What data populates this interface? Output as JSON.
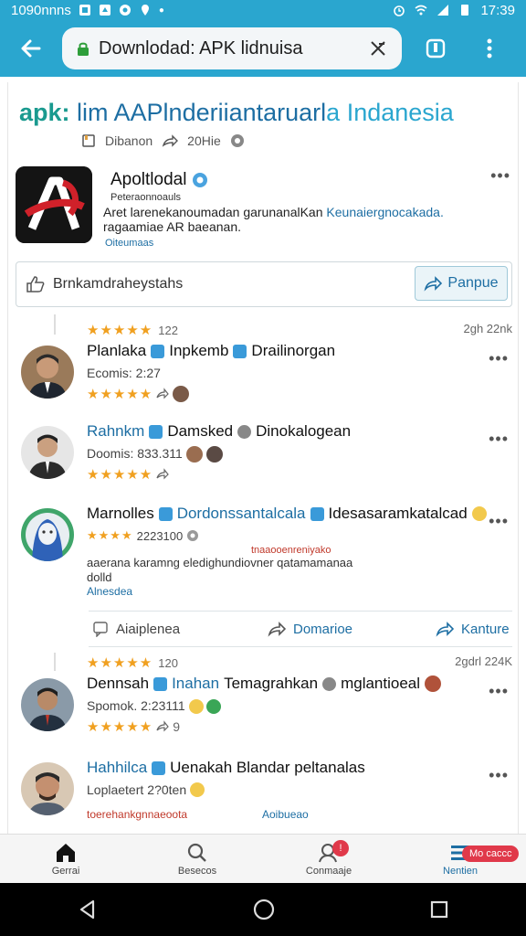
{
  "status_bar": {
    "left_text": "1090nnns",
    "time": "17:39"
  },
  "browser": {
    "url_text": "Downlodad: APK lidnuisa",
    "icons": [
      "back-arrow-icon",
      "lock-icon",
      "clear-icon",
      "tabs-icon",
      "overflow-menu-icon"
    ]
  },
  "site": {
    "title_brand": "apk:",
    "title_mid": " lim AAPlnderiiantaruarl",
    "title_tail": "a Indanesia",
    "meta_left": "Dibanon",
    "meta_share": "20Hie"
  },
  "app": {
    "name": "Apoltlodal",
    "sub": "Peteraonnoauls",
    "desc_main": "Aret larenekanoumadan garunanalKan ",
    "desc_highlight": "Keunaiergnocakada.",
    "desc_line2": "ragaamiae AR baeanan.",
    "tag": "Oiteumaas"
  },
  "action_bar": {
    "label": "Brnkamdraheystahs",
    "button_label": "Panpue"
  },
  "review_group_1": {
    "rating_text": "122",
    "date": "2gh 22nk"
  },
  "reviews": [
    {
      "name_a": "Planlaka",
      "name_b": "Inpkemb",
      "name_c": "Drailinorgan",
      "meta": "Ecomis:  2:27",
      "stars": "★★★★★"
    },
    {
      "name_a": "Rahnkm",
      "name_b": "Damsked",
      "name_c": "Dinokalogean",
      "meta": "Doomis:   833.311",
      "stars": "★★★★★"
    },
    {
      "name_a": "Marnolles",
      "name_b": "Dordonssantalcala",
      "name_c": "Idesasaramkatalcad",
      "meta": "2223100",
      "stars": "★★★★",
      "text_red": "tnaaooenreniyako",
      "text_line1": "aaerana karamng eledighundiovner qatamamanaa",
      "text_line2": "dolld",
      "link": "Alnesdea"
    }
  ],
  "split_actions": {
    "left": "Aiaiplenea",
    "middle": "Domarioe",
    "right": "Kanture"
  },
  "review_group_2": {
    "rating_text": "120",
    "date": "2gdrl 224K"
  },
  "reviews_2": [
    {
      "name_a": "Dennsah",
      "name_b": "Inahan",
      "name_c": "Temagrahkan",
      "name_d": "mglantioeal",
      "meta": "Spomok.   2:23111",
      "stars": "★★★★★",
      "extra": "9"
    },
    {
      "name_a": "Hahhilca",
      "name_b": "Uenakah Blandar peltanalas",
      "meta": "Loplaetert",
      "meta_num": "2?0ten",
      "foot_red": "toerehankgnnaeoota",
      "foot_link": "Aoibueao"
    }
  ],
  "bottom_nav": [
    {
      "label": "Gerrai",
      "icon": "home-icon"
    },
    {
      "label": "Besecos",
      "icon": "search-icon"
    },
    {
      "label": "Conmaaje",
      "icon": "messages-icon",
      "badge": "!"
    },
    {
      "label": "Nentien",
      "icon": "menu-icon",
      "badge": "Mo caccc"
    }
  ],
  "system_nav": [
    "back-triangle-icon",
    "home-circle-icon",
    "recents-square-icon"
  ],
  "colors": {
    "primary": "#2aa6cf",
    "brand_green": "#1a9a8f",
    "link_blue": "#1d6ea3",
    "star": "#f0a020",
    "badge_red": "#e0394a"
  }
}
